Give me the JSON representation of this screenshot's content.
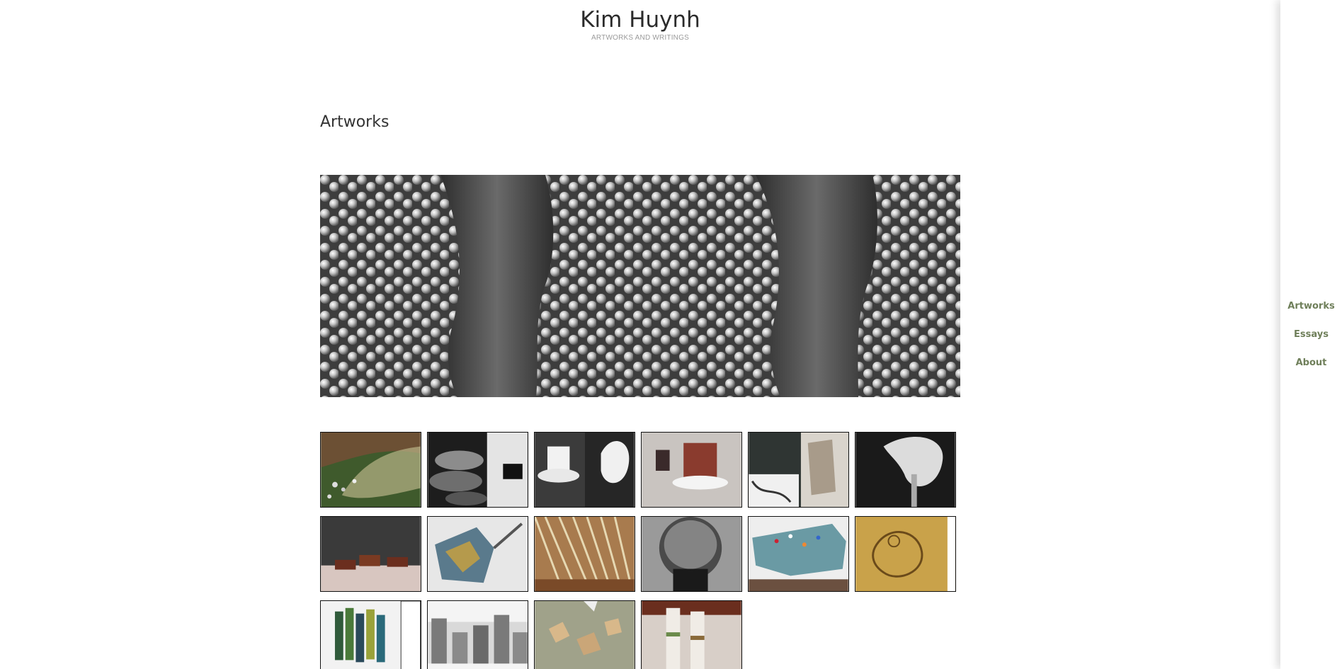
{
  "site": {
    "title": "Kim Huynh",
    "tagline": "ARTWORKS AND WRITINGS"
  },
  "page": {
    "heading": "Artworks"
  },
  "hero": {
    "icon": "pearl-artwork-image"
  },
  "gallery": {
    "items": [
      {
        "icon": "green-leaf-artwork-image"
      },
      {
        "icon": "black-hats-artwork-image"
      },
      {
        "icon": "white-hats-artwork-image"
      },
      {
        "icon": "red-top-hat-artwork-image"
      },
      {
        "icon": "sketch-collage-artwork-image"
      },
      {
        "icon": "white-bonnet-artwork-image"
      },
      {
        "icon": "floor-bricks-artwork-image"
      },
      {
        "icon": "photo-mosaic-artwork-image"
      },
      {
        "icon": "straw-strands-artwork-image"
      },
      {
        "icon": "pearl-head-artwork-image"
      },
      {
        "icon": "map-pins-artwork-image"
      },
      {
        "icon": "figure-drawing-artwork-image"
      },
      {
        "icon": "painted-panels-artwork-image"
      },
      {
        "icon": "letters-sculpture-artwork-image"
      },
      {
        "icon": "floor-cutouts-artwork-image"
      },
      {
        "icon": "columns-installation-artwork-image"
      }
    ]
  },
  "nav": {
    "artworks": "Artworks",
    "essays": "Essays",
    "about": "About",
    "accent_color": "#6f7f5a"
  }
}
